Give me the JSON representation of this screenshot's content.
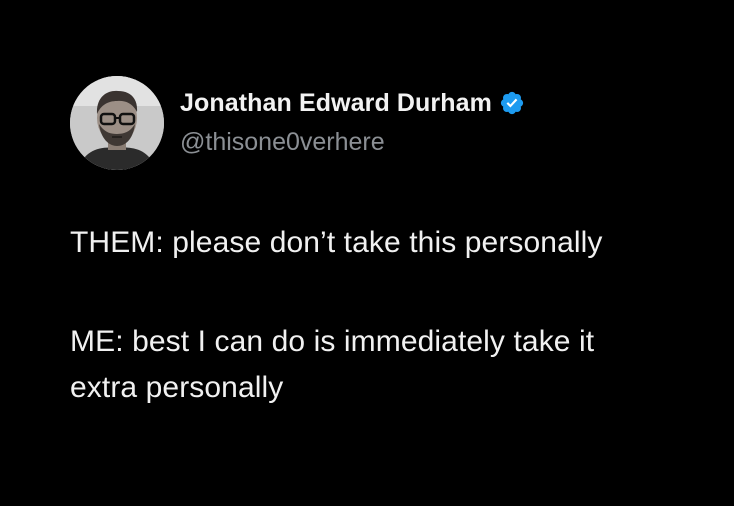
{
  "tweet": {
    "author": {
      "display_name": "Jonathan Edward Durham",
      "handle": "@thisone0verhere",
      "verified": true,
      "verified_color": "#1d9bf0",
      "avatar_icon": "profile-photo"
    },
    "text_lines": [
      "THEM: please don’t take this personally",
      "ME: best I can do is immediately take it",
      "extra personally"
    ]
  },
  "colors": {
    "background": "#000000",
    "name": "#f2f2f2",
    "handle": "#8b8f94",
    "body": "#f1f1f1"
  }
}
